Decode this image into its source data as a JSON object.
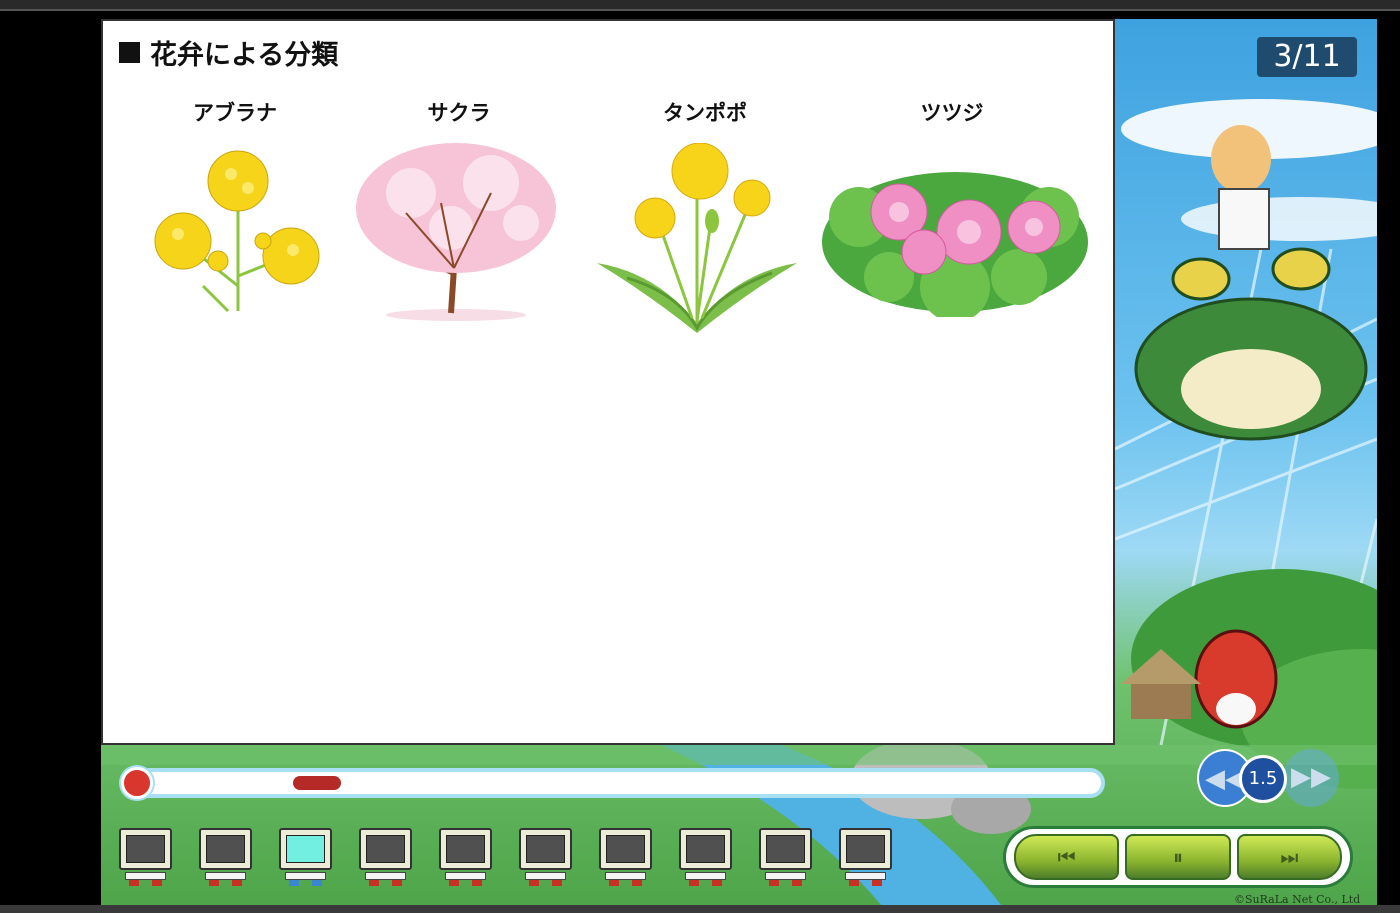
{
  "slide": {
    "title": "花弁による分類",
    "flowers": [
      {
        "name": "アブラナ"
      },
      {
        "name": "サクラ"
      },
      {
        "name": "タンポポ"
      },
      {
        "name": "ツツジ"
      }
    ]
  },
  "page_counter": "3/11",
  "progress": {
    "played_fraction": 0.015,
    "buffered_fraction": 0.22
  },
  "chapters": {
    "count": 10,
    "current_index": 2
  },
  "speed": {
    "value": "1.5",
    "slower_icon": "rewind-icon",
    "faster_icon": "fast-forward-icon"
  },
  "playback": {
    "prev_icon": "skip-back-icon",
    "pause_icon": "pause-icon",
    "next_icon": "skip-forward-icon"
  },
  "copyright": "©SuRaLa Net Co., Ltd",
  "colors": {
    "progress": "#d03a30",
    "counter_bg": "#1f4b6e",
    "current_chapter": "#72efe0"
  }
}
